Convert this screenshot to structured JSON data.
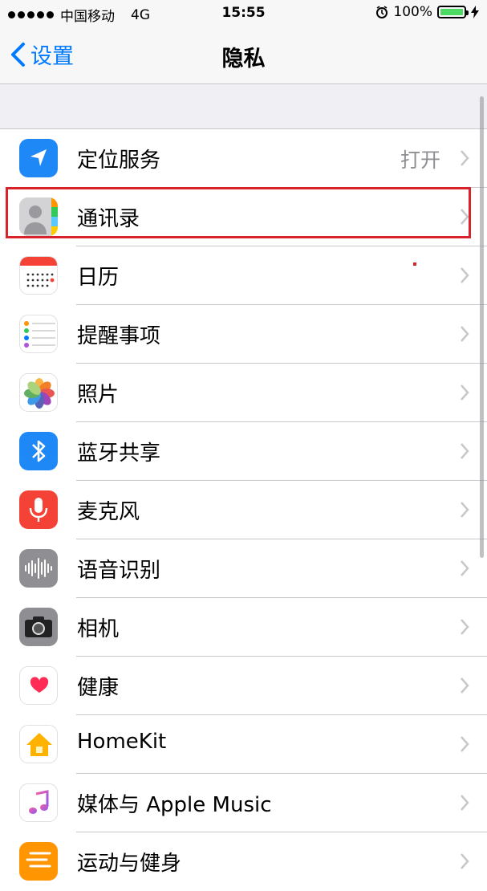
{
  "status": {
    "carrier": "中国移动",
    "network": "4G",
    "time": "15:55",
    "battery": "100%"
  },
  "nav": {
    "back_label": "设置",
    "title": "隐私"
  },
  "rows": [
    {
      "label": "定位服务",
      "value": "打开"
    },
    {
      "label": "通讯录"
    },
    {
      "label": "日历"
    },
    {
      "label": "提醒事项"
    },
    {
      "label": "照片"
    },
    {
      "label": "蓝牙共享"
    },
    {
      "label": "麦克风"
    },
    {
      "label": "语音识别"
    },
    {
      "label": "相机"
    },
    {
      "label": "健康"
    },
    {
      "label": "HomeKit"
    },
    {
      "label": "媒体与 Apple Music"
    },
    {
      "label": "运动与健身"
    }
  ],
  "colors": {
    "tint": "#007aff",
    "highlight": "#d8232a",
    "battery": "#4cd964"
  }
}
